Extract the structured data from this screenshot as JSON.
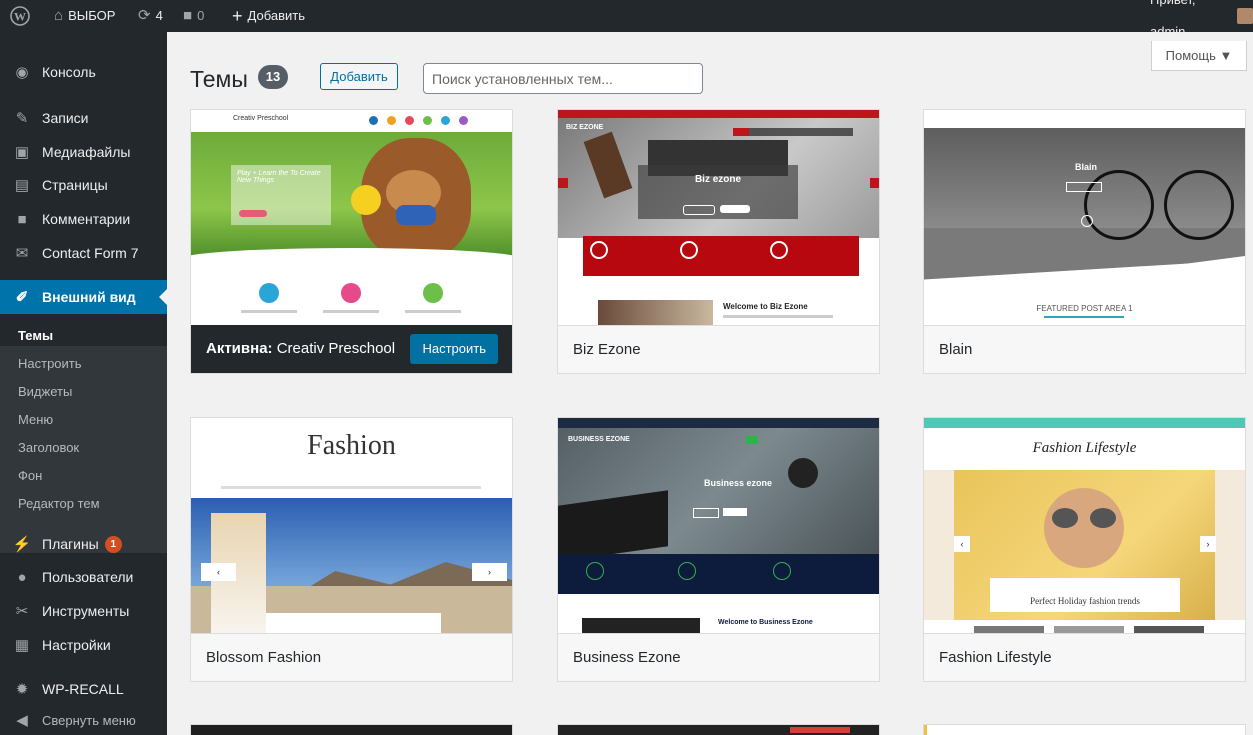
{
  "adminbar": {
    "site_name": "ВЫБОР",
    "updates_count": "4",
    "comments_count": "0",
    "add_new": "Добавить",
    "greeting": "Привет, admin"
  },
  "help_tab": "Помощь ▼",
  "sidebar": {
    "items": [
      {
        "label": "Консоль",
        "icon": "dashboard-icon"
      },
      {
        "label": "Записи",
        "icon": "pin-icon"
      },
      {
        "label": "Медиафайлы",
        "icon": "media-icon"
      },
      {
        "label": "Страницы",
        "icon": "pages-icon"
      },
      {
        "label": "Комментарии",
        "icon": "comment-icon"
      },
      {
        "label": "Contact Form 7",
        "icon": "mail-icon"
      },
      {
        "label": "Внешний вид",
        "icon": "brush-icon"
      },
      {
        "label": "Плагины",
        "icon": "plugin-icon",
        "badge": "1"
      },
      {
        "label": "Пользователи",
        "icon": "users-icon"
      },
      {
        "label": "Инструменты",
        "icon": "wrench-icon"
      },
      {
        "label": "Настройки",
        "icon": "settings-icon"
      },
      {
        "label": "WP-RECALL",
        "icon": "gear-icon"
      },
      {
        "label": "Свернуть меню",
        "icon": "collapse-icon"
      }
    ],
    "submenu": [
      "Темы",
      "Настроить",
      "Виджеты",
      "Меню",
      "Заголовок",
      "Фон",
      "Редактор тем"
    ]
  },
  "header": {
    "title": "Темы",
    "count": "13",
    "add_label": "Добавить",
    "search_placeholder": "Поиск установленных тем..."
  },
  "themes": {
    "active_label": "Активна:",
    "active_name": "Creativ Preschool",
    "customize_label": "Настроить",
    "names": [
      "Biz Ezone",
      "Blain",
      "Blossom Fashion",
      "Business Ezone",
      "Fashion Lifestyle"
    ]
  },
  "screenshots": {
    "preschool_brand": "Creativ Preschool",
    "preschool_hero": "Play + Learn the To Create New Things",
    "biz_brand": "BIZ EZONE",
    "biz_hero": "Biz ezone",
    "biz_welcome": "Welcome to Biz Ezone",
    "blain_hero": "Blain",
    "blain_featured": "FEATURED POST AREA 1",
    "fashion_logo": "Fashion",
    "business_brand": "BUSINESS EZONE",
    "business_hero": "Business ezone",
    "business_welcome": "Welcome to Business Ezone",
    "lifestyle_logo": "Fashion Lifestyle",
    "lifestyle_caption": "Perfect Holiday fashion trends"
  },
  "colors": {
    "admin_dark": "#23282d",
    "accent_blue": "#0073aa",
    "button_blue": "#0071a1",
    "badge_orange": "#d54e21"
  }
}
